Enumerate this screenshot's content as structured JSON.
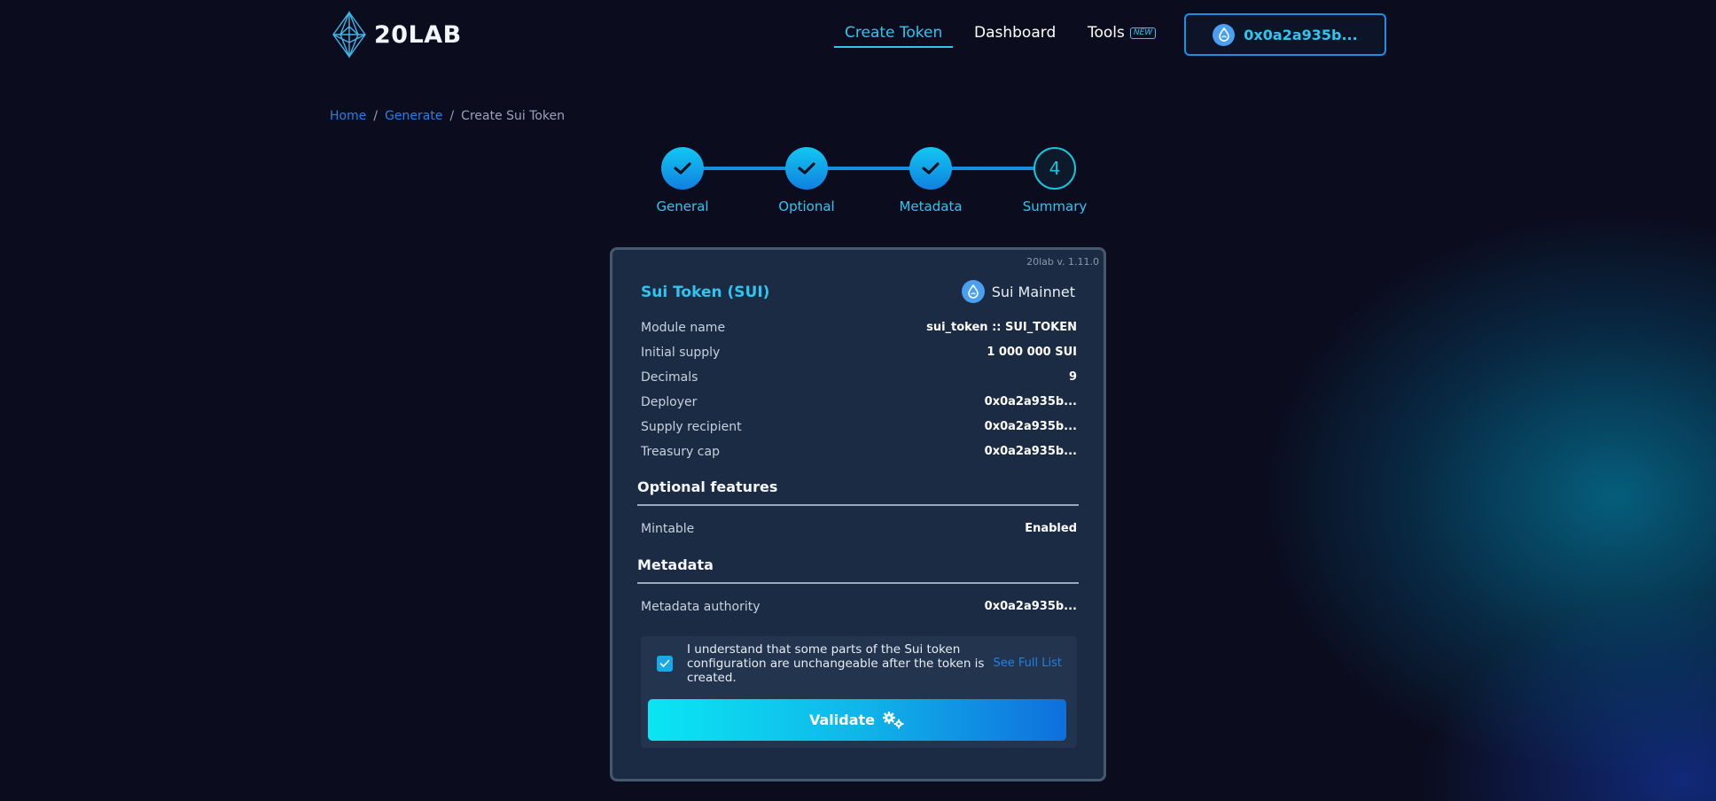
{
  "header": {
    "logo_text": "20LAB",
    "nav": [
      {
        "label": "Create Token",
        "active": true
      },
      {
        "label": "Dashboard",
        "active": false
      },
      {
        "label": "Tools",
        "active": false,
        "badge": "NEW"
      }
    ],
    "wallet_address": "0x0a2a935b..."
  },
  "breadcrumb": {
    "items": [
      "Home",
      "Generate"
    ],
    "current": "Create Sui Token",
    "separator": "/"
  },
  "stepper": {
    "steps": [
      {
        "label": "General",
        "state": "done"
      },
      {
        "label": "Optional",
        "state": "done"
      },
      {
        "label": "Metadata",
        "state": "done"
      },
      {
        "label": "Summary",
        "state": "current",
        "number": "4"
      }
    ]
  },
  "card": {
    "version": "20lab v. 1.11.0",
    "token_title": "Sui Token (SUI)",
    "network": "Sui Mainnet",
    "general_rows": [
      {
        "key": "Module name",
        "value": "sui_token :: SUI_TOKEN"
      },
      {
        "key": "Initial supply",
        "value": "1 000 000 SUI"
      },
      {
        "key": "Decimals",
        "value": "9"
      },
      {
        "key": "Deployer",
        "value": "0x0a2a935b..."
      },
      {
        "key": "Supply recipient",
        "value": "0x0a2a935b..."
      },
      {
        "key": "Treasury cap",
        "value": "0x0a2a935b..."
      }
    ],
    "optional_title": "Optional features",
    "optional_rows": [
      {
        "key": "Mintable",
        "value": "Enabled"
      }
    ],
    "metadata_title": "Metadata",
    "metadata_rows": [
      {
        "key": "Metadata authority",
        "value": "0x0a2a935b..."
      }
    ],
    "consent": {
      "checked": true,
      "text": "I understand that some parts of the Sui token configuration are unchangeable after the token is created.",
      "link": "See Full List"
    },
    "validate_label": "Validate"
  },
  "colors": {
    "accent": "#2ec6f0",
    "link": "#1f82e6",
    "card_bg": "#1b2b43",
    "page_bg": "#0b0d1f"
  }
}
